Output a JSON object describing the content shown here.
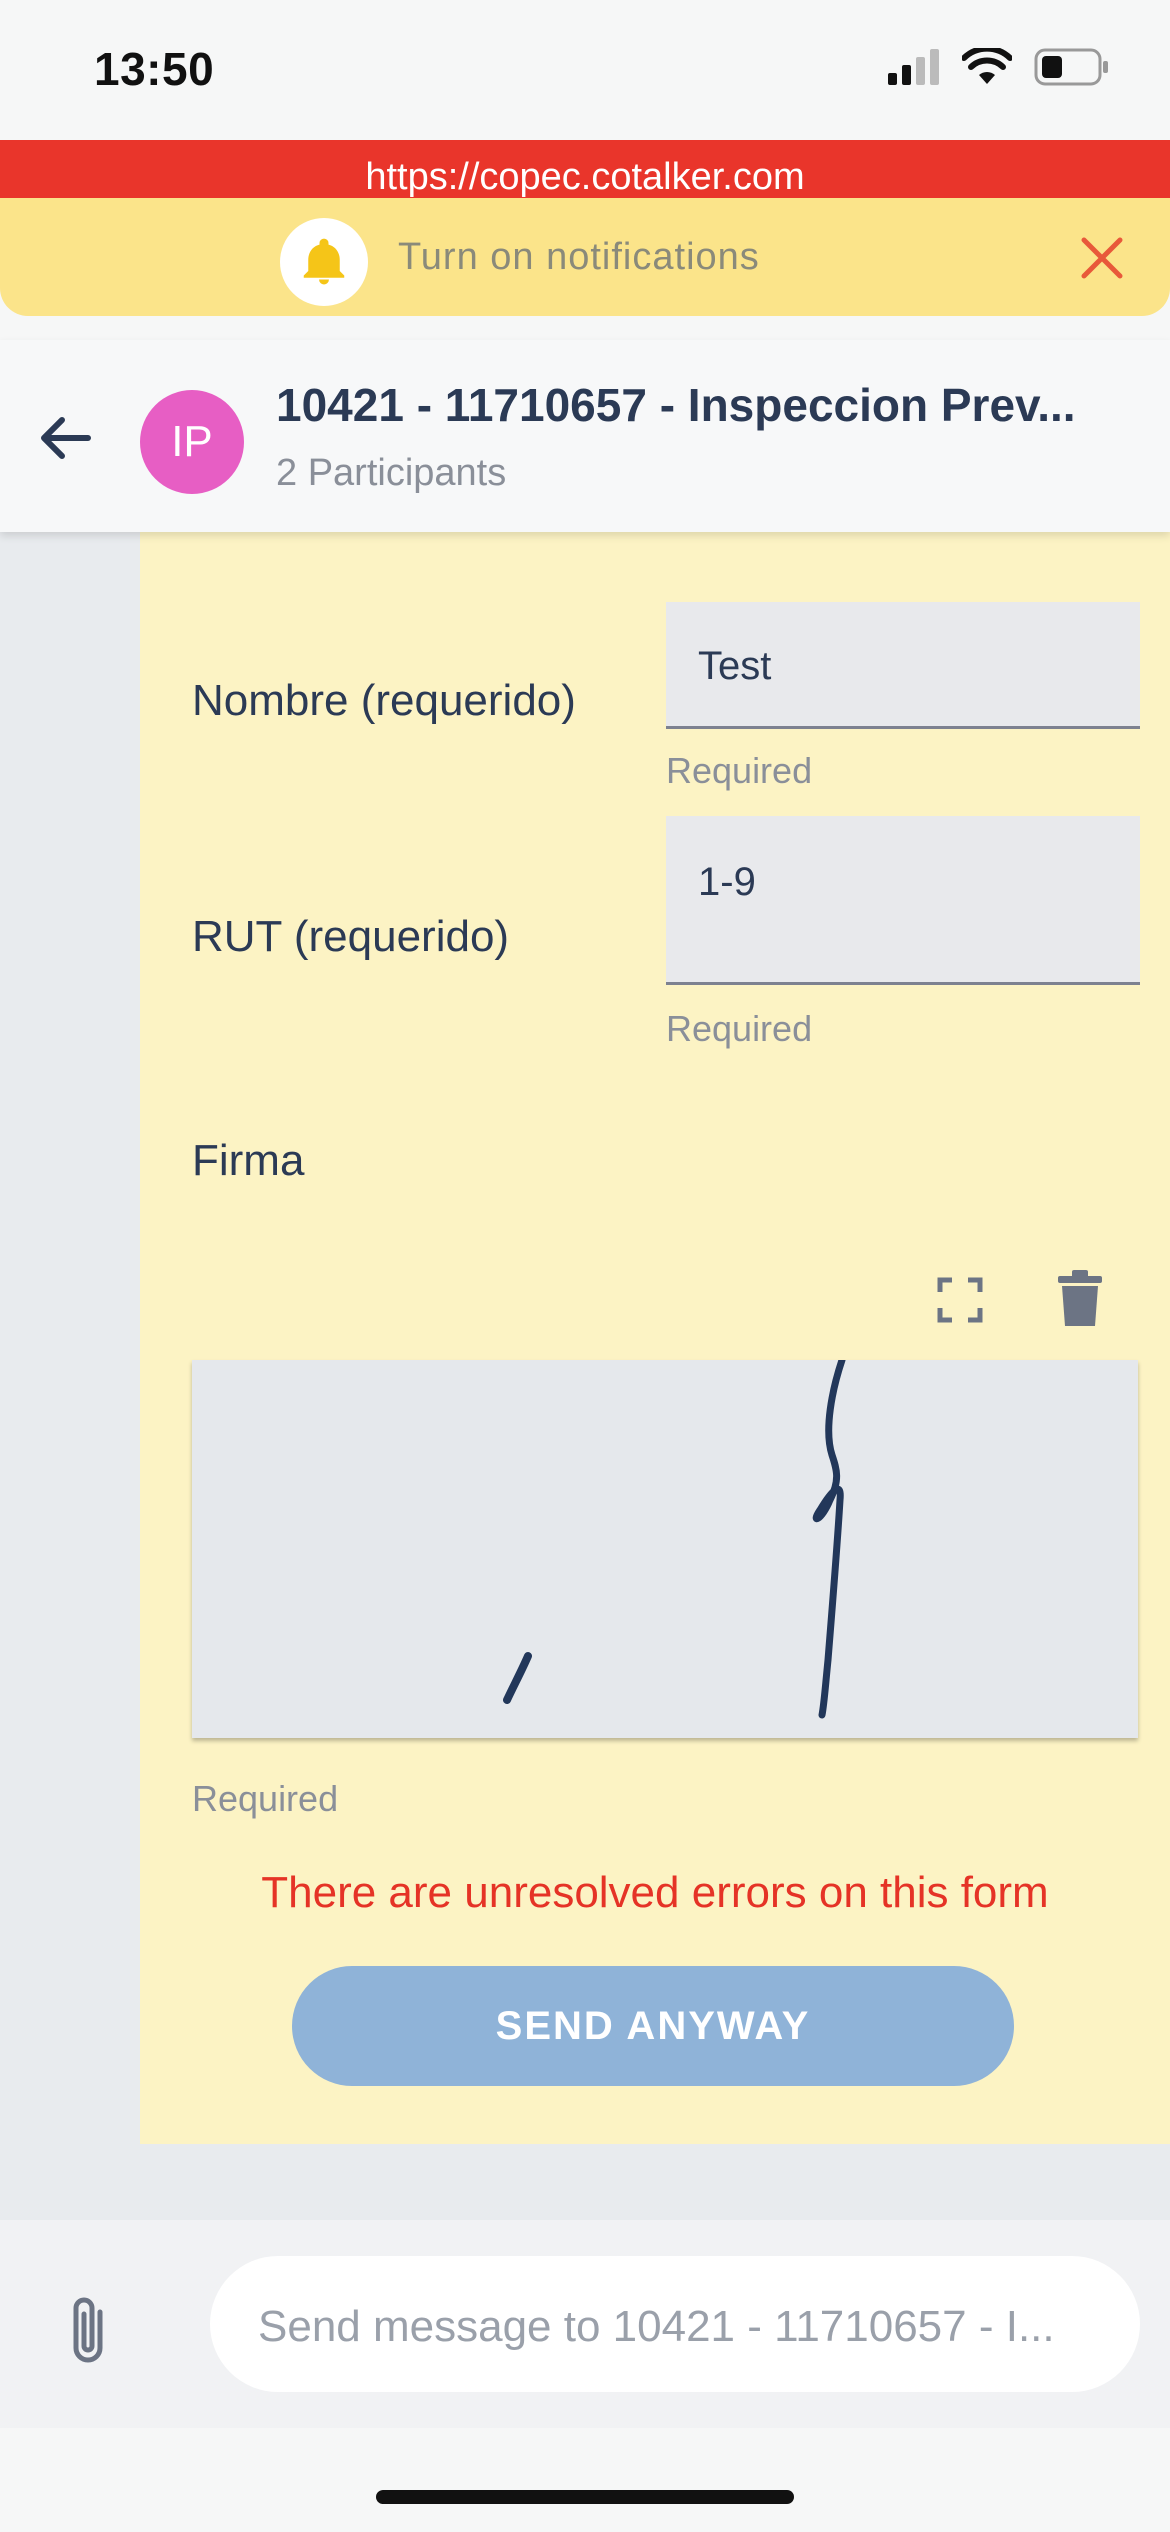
{
  "status_bar": {
    "time": "13:50"
  },
  "browser": {
    "url": "https://copec.cotalker.com"
  },
  "notification": {
    "text": "Turn on notifications"
  },
  "chat": {
    "avatar_initials": "IP",
    "title": "10421 - 11710657 - Inspeccion Prev...",
    "subtitle": "2 Participants"
  },
  "form": {
    "nombre": {
      "label": "Nombre (requerido)",
      "value": "Test",
      "helper": "Required"
    },
    "rut": {
      "label": "RUT (requerido)",
      "value": "1-9",
      "helper": "Required"
    },
    "firma": {
      "label": "Firma",
      "helper": "Required"
    },
    "error_message": "There are unresolved errors on this form",
    "send_button": "SEND ANYWAY"
  },
  "composer": {
    "placeholder": "Send message to 10421 - 11710657 - I..."
  },
  "colors": {
    "url_bar": "#e9352b",
    "notification_bar": "#fbe48a",
    "avatar": "#e75ec4",
    "form_card": "#fcf3c4",
    "error": "#e53326",
    "send_button": "#8fb3d8"
  },
  "icons": [
    "signal-icon",
    "wifi-icon",
    "battery-icon",
    "bell-icon",
    "close-icon",
    "back-arrow-icon",
    "fullscreen-icon",
    "trash-icon",
    "paperclip-icon"
  ]
}
